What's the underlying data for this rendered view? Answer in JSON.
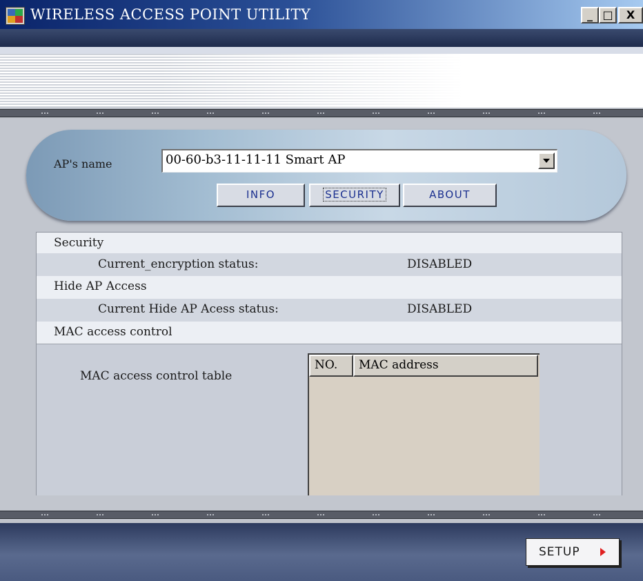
{
  "window": {
    "title": "WIRELESS ACCESS POINT UTILITY",
    "icon": "network-app-icon",
    "controls": {
      "minimize": "_",
      "maximize": "□",
      "close": "X"
    }
  },
  "ap": {
    "label": "AP's name",
    "selected": "00-60-b3-11-11-11 Smart AP"
  },
  "tabs": [
    {
      "label": "INFO",
      "active": false
    },
    {
      "label": "SECURITY",
      "active": true
    },
    {
      "label": "ABOUT",
      "active": false
    }
  ],
  "security": {
    "section_title": "Security",
    "encryption_label": "Current_encryption status:",
    "encryption_value": "DISABLED",
    "hide_title": "Hide AP Access",
    "hide_label": "Current Hide AP Acess status:",
    "hide_value": "DISABLED",
    "mac_title": "MAC access control",
    "mac_table_label": "MAC access control table",
    "mac_columns": [
      "NO.",
      "MAC address"
    ],
    "mac_rows": []
  },
  "footer": {
    "setup_label": "SETUP",
    "arrow_color": "#e02020"
  }
}
